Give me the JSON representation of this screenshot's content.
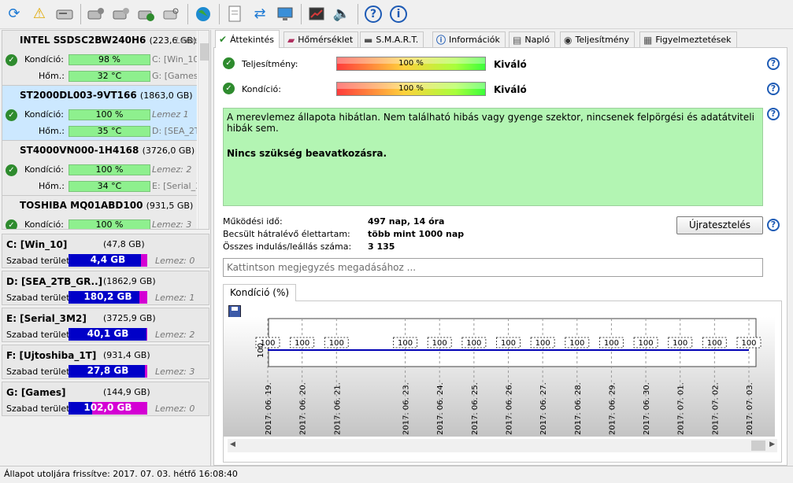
{
  "toolbar": {
    "icons": [
      "refresh-icon",
      "warning-icon",
      "drive-icon",
      "drive-wrench-icon",
      "drive-tool-icon",
      "drive-check-icon",
      "drive-search-icon",
      "globe-icon",
      "document-icon",
      "sync-icon",
      "monitor-icon",
      "chart-window-icon",
      "speaker-icon",
      "help-icon",
      "info-icon"
    ]
  },
  "disks": [
    {
      "name": "INTEL SSDSC2BW240H6",
      "size": "(223,6 GB)",
      "lemez": "Lemez 0",
      "kondicio_label": "Kondíció:",
      "kondicio": "98 %",
      "hom_label": "Hőm.:",
      "hom": "32 °C",
      "drive1": "C: [Win_10]",
      "drive2": "G: [Games]"
    },
    {
      "name": "ST2000DL003-9VT166",
      "size": "(1863,0 GB)",
      "lemez": "Lemez 1",
      "kondicio_label": "Kondíció:",
      "kondicio": "100 %",
      "hom_label": "Hőm.:",
      "hom": "35 °C",
      "drive2": "D: [SEA_2TB_GR..]"
    },
    {
      "name": "ST4000VN000-1H4168",
      "size": "(3726,0 GB)",
      "lemez": "Lemez: 2",
      "kondicio_label": "Kondíció:",
      "kondicio": "100 %",
      "hom_label": "Hőm.:",
      "hom": "34 °C",
      "drive2": "E: [Serial_3M2]"
    },
    {
      "name": "TOSHIBA MQ01ABD100",
      "size": "(931,5 GB)",
      "lemez": "Lemez: 3",
      "kondicio_label": "Kondíció:",
      "kondicio": "100 %"
    }
  ],
  "partitions": [
    {
      "name": "C: [Win_10]",
      "size": "(47,8 GB)",
      "free_label": "Szabad terület",
      "free": "4,4 GB",
      "used_frac": 0.08,
      "lemez": "Lemez: 0"
    },
    {
      "name": "D: [SEA_2TB_GR..]",
      "size": "(1862,9 GB)",
      "free_label": "Szabad terület",
      "free": "180,2 GB",
      "used_frac": 0.1,
      "lemez": "Lemez: 1"
    },
    {
      "name": "E: [Serial_3M2]",
      "size": "(3725,9 GB)",
      "free_label": "Szabad terület",
      "free": "40,1 GB",
      "used_frac": 0.01,
      "lemez": "Lemez: 2"
    },
    {
      "name": "F: [Ujtoshiba_1T]",
      "size": "(931,4 GB)",
      "free_label": "Szabad terület",
      "free": "27,8 GB",
      "used_frac": 0.03,
      "lemez": "Lemez: 3"
    },
    {
      "name": "G: [Games]",
      "size": "(144,9 GB)",
      "free_label": "Szabad terület",
      "free": "102,0 GB",
      "used_frac": 0.7,
      "lemez": "Lemez: 0"
    }
  ],
  "tabs": [
    {
      "label": "Áttekintés",
      "icon": "check-icon"
    },
    {
      "label": "Hőmérséklet",
      "icon": "thermometer-icon"
    },
    {
      "label": "S.M.A.R.T.",
      "icon": "smart-icon"
    },
    {
      "label": "Információk",
      "icon": "info-icon"
    },
    {
      "label": "Napló",
      "icon": "log-icon"
    },
    {
      "label": "Teljesítmény",
      "icon": "gauge-icon"
    },
    {
      "label": "Figyelmeztetések",
      "icon": "alert-doc-icon"
    }
  ],
  "overview": {
    "teljesitmeny_label": "Teljesítmény:",
    "teljesitmeny_value": "100 %",
    "teljesitmeny_status": "Kiváló",
    "kondicio_label": "Kondíció:",
    "kondicio_value": "100 %",
    "kondicio_status": "Kiváló",
    "message": "A merevlemez állapota hibátlan. Nem található hibás vagy gyenge szektor, nincsenek felpörgési és adatátviteli hibák sem.",
    "message_bold": "Nincs szükség beavatkozásra.",
    "stats": [
      {
        "label": "Működési idő:",
        "value": "497 nap, 14 óra"
      },
      {
        "label": "Becsült hátralévő élettartam:",
        "value": "több mint 1000 nap"
      },
      {
        "label": "Összes indulás/leállás száma:",
        "value": "3 135"
      }
    ],
    "retest_button": "Újratesztelés",
    "note_placeholder": "Kattintson megjegyzés megadásához ..."
  },
  "chart_tab": "Kondíció  (%)",
  "chart_data": {
    "type": "line",
    "x": [
      "2017. 06. 19.",
      "2017. 06. 20.",
      "2017. 06. 21.",
      "2017. 06. 23.",
      "2017. 06. 24.",
      "2017. 06. 25.",
      "2017. 06. 26.",
      "2017. 06. 27.",
      "2017. 06. 28.",
      "2017. 06. 29.",
      "2017. 06. 30.",
      "2017. 07. 01.",
      "2017. 07. 02.",
      "2017. 07. 03."
    ],
    "series": [
      {
        "values": [
          100,
          100,
          100,
          100,
          100,
          100,
          100,
          100,
          100,
          100,
          100,
          100,
          100,
          100
        ]
      }
    ],
    "ylabel_tick": "100",
    "grid": true,
    "color": "#0000b4"
  },
  "status": "Állapot utoljára frissítve: 2017. 07. 03. hétfő 16:08:40"
}
